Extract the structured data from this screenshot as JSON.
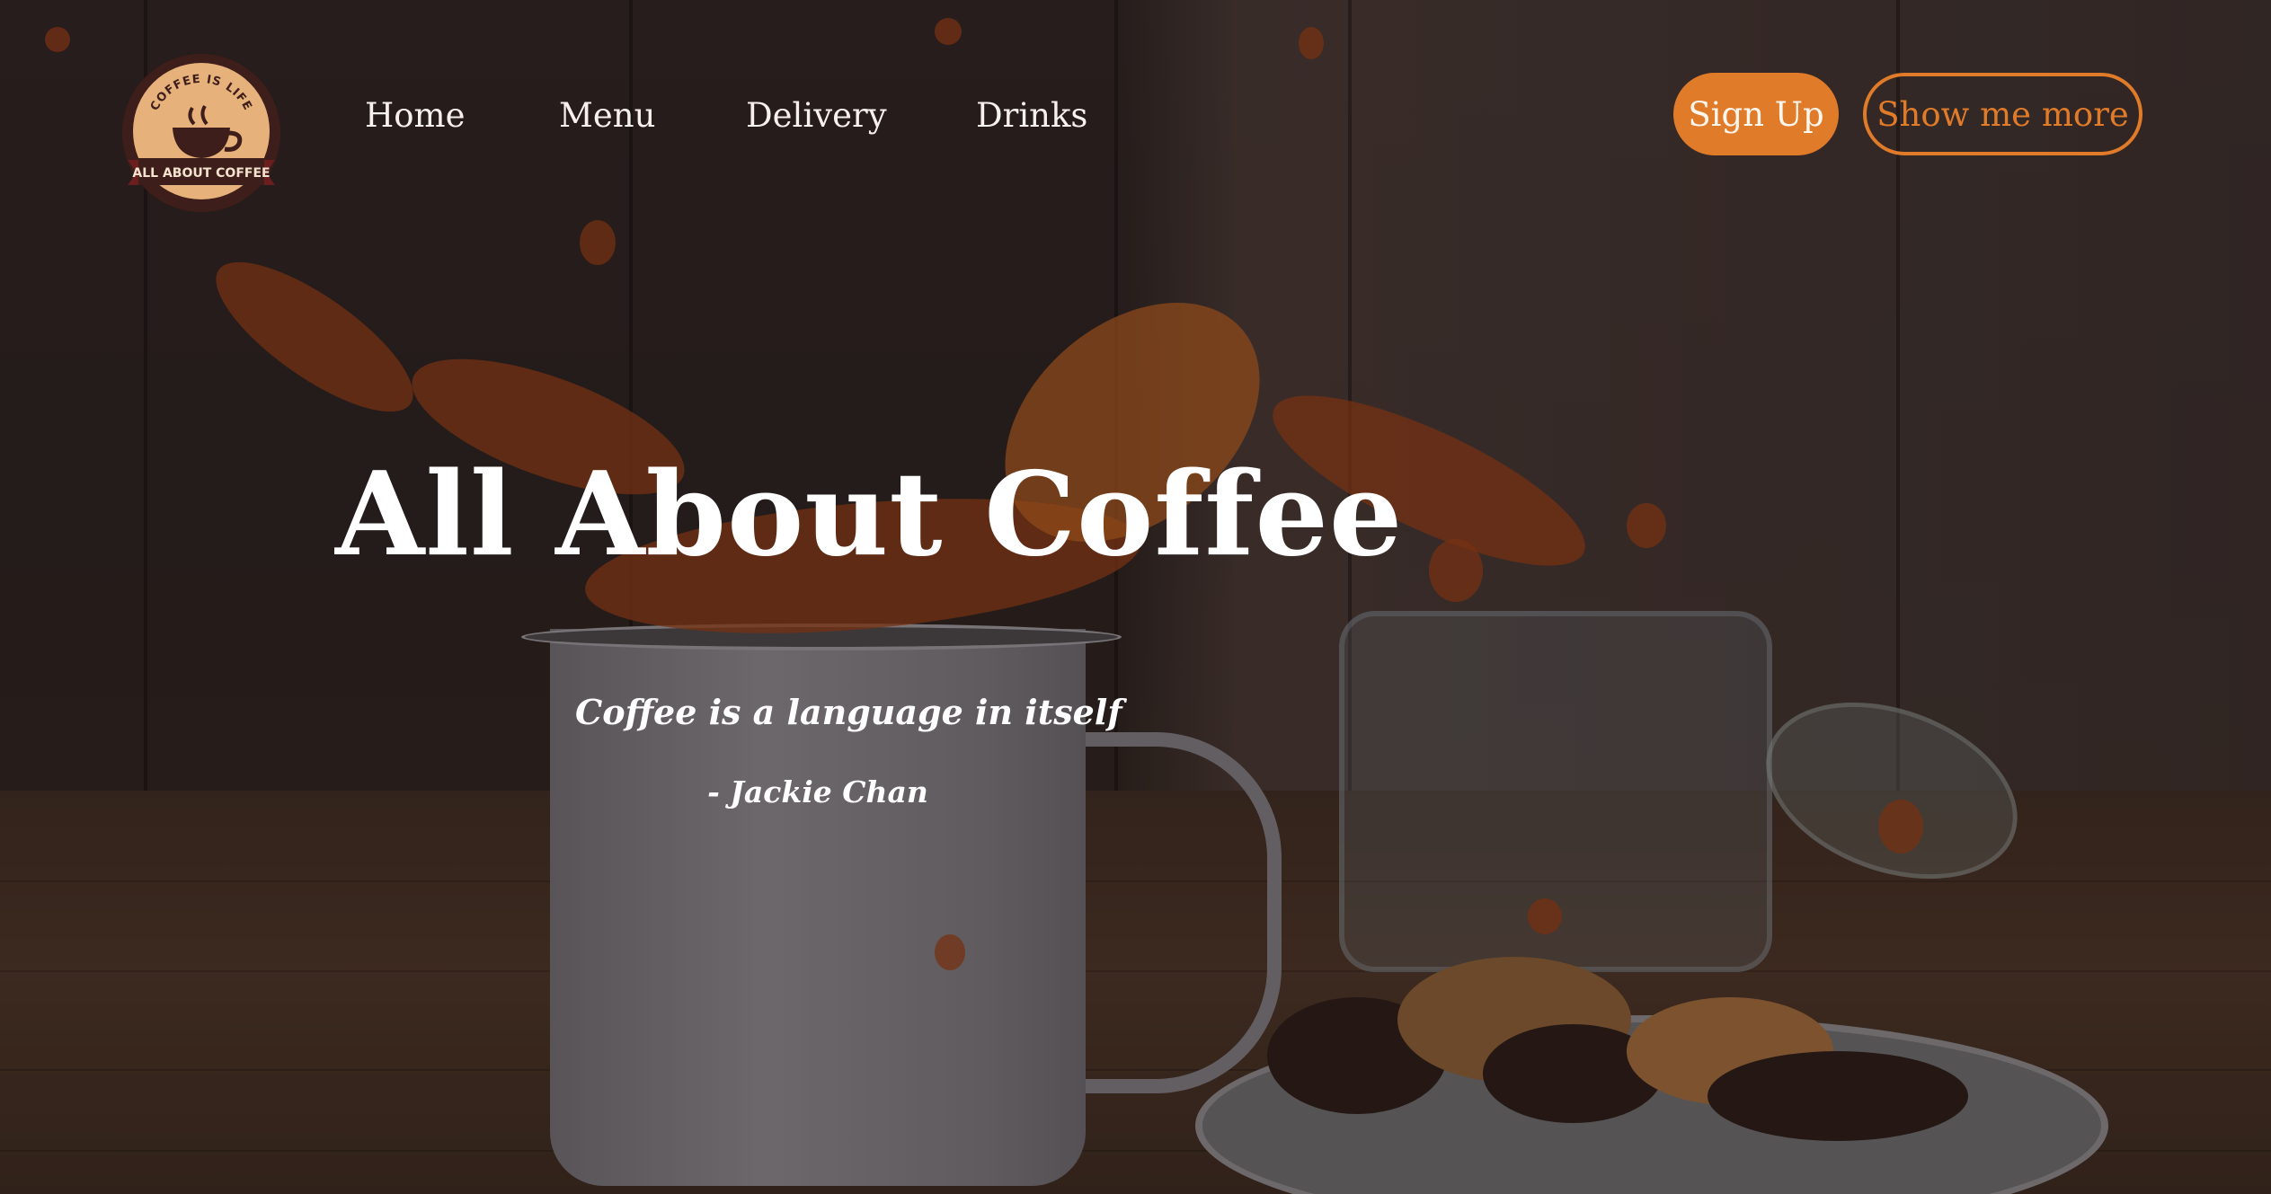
{
  "logo": {
    "arc_text": "COFFEE IS LIFE",
    "banner_text": "ALL ABOUT COFFEE"
  },
  "nav": {
    "items": [
      {
        "label": "Home"
      },
      {
        "label": "Menu"
      },
      {
        "label": "Delivery"
      },
      {
        "label": "Drinks"
      }
    ]
  },
  "actions": {
    "signup_label": "Sign Up",
    "more_label": "Show me more"
  },
  "hero": {
    "title": "All About Coffee",
    "quote": "Coffee is a language in itself",
    "author": "- Jackie Chan"
  },
  "colors": {
    "accent": "#e07b2a",
    "text": "#ffffff",
    "logo_bg": "#3e1e1b",
    "logo_cream": "#e6b17a"
  }
}
